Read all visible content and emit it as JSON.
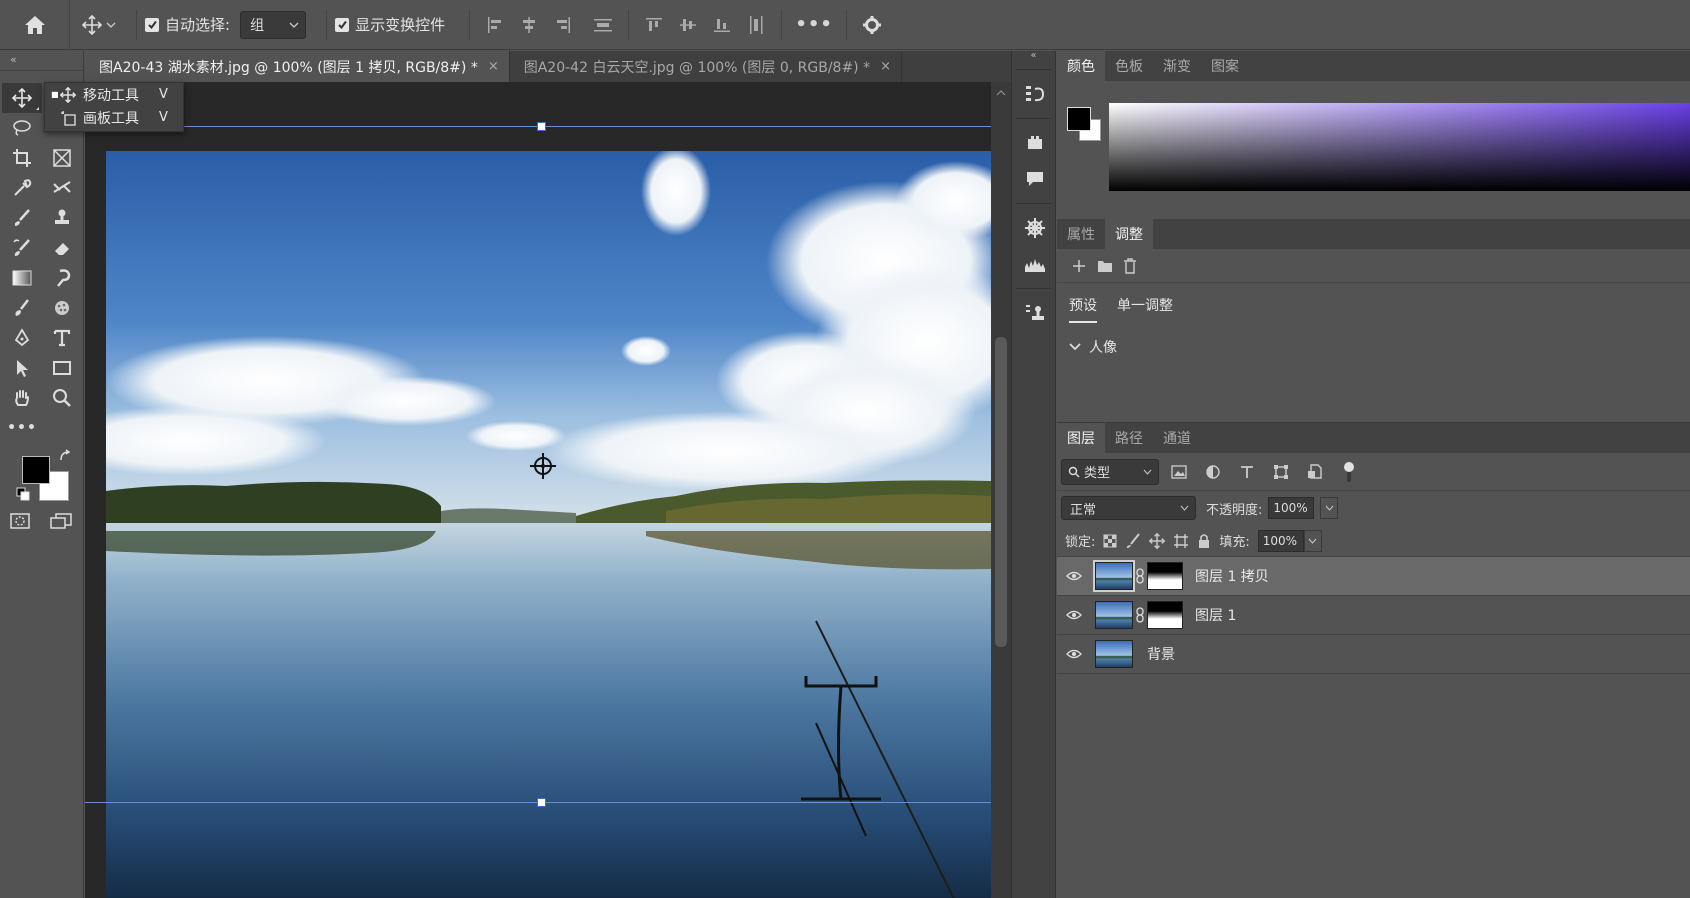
{
  "options_bar": {
    "auto_select_label": "自动选择:",
    "auto_select_value": "组",
    "show_transform_label": "显示变换控件",
    "more_label": "•••"
  },
  "flyout": {
    "items": [
      {
        "label": "移动工具",
        "key": "V"
      },
      {
        "label": "画板工具",
        "key": "V"
      }
    ]
  },
  "tabs": [
    {
      "label": "图A20-43 湖水素材.jpg @ 100% (图层 1 拷贝, RGB/8#) *",
      "close": "×"
    },
    {
      "label": "图A20-42 白云天空.jpg @ 100% (图层 0, RGB/8#) *",
      "close": "×"
    }
  ],
  "color_panel": {
    "tabs": [
      "颜色",
      "色板",
      "渐变",
      "图案"
    ],
    "foreground": "#000000",
    "background": "#ffffff"
  },
  "adjust_panel": {
    "tabs": [
      "属性",
      "调整"
    ],
    "subtabs": [
      "预设",
      "单一调整"
    ],
    "group_label": "人像"
  },
  "layers_panel": {
    "tabs": [
      "图层",
      "路径",
      "通道"
    ],
    "filter_label": "类型",
    "blend_mode": "正常",
    "opacity_label": "不透明度:",
    "opacity_value": "100%",
    "lock_label": "锁定:",
    "fill_label": "填充:",
    "fill_value": "100%",
    "layers": [
      {
        "name": "图层 1 拷贝",
        "selected": true,
        "has_mask": true
      },
      {
        "name": "图层 1",
        "selected": false,
        "has_mask": true
      },
      {
        "name": "背景",
        "selected": false,
        "has_mask": false
      }
    ]
  },
  "colors": {
    "accent_guide": "#6b8fd6",
    "panel_bg": "#535353",
    "canvas_bg": "#282828"
  }
}
